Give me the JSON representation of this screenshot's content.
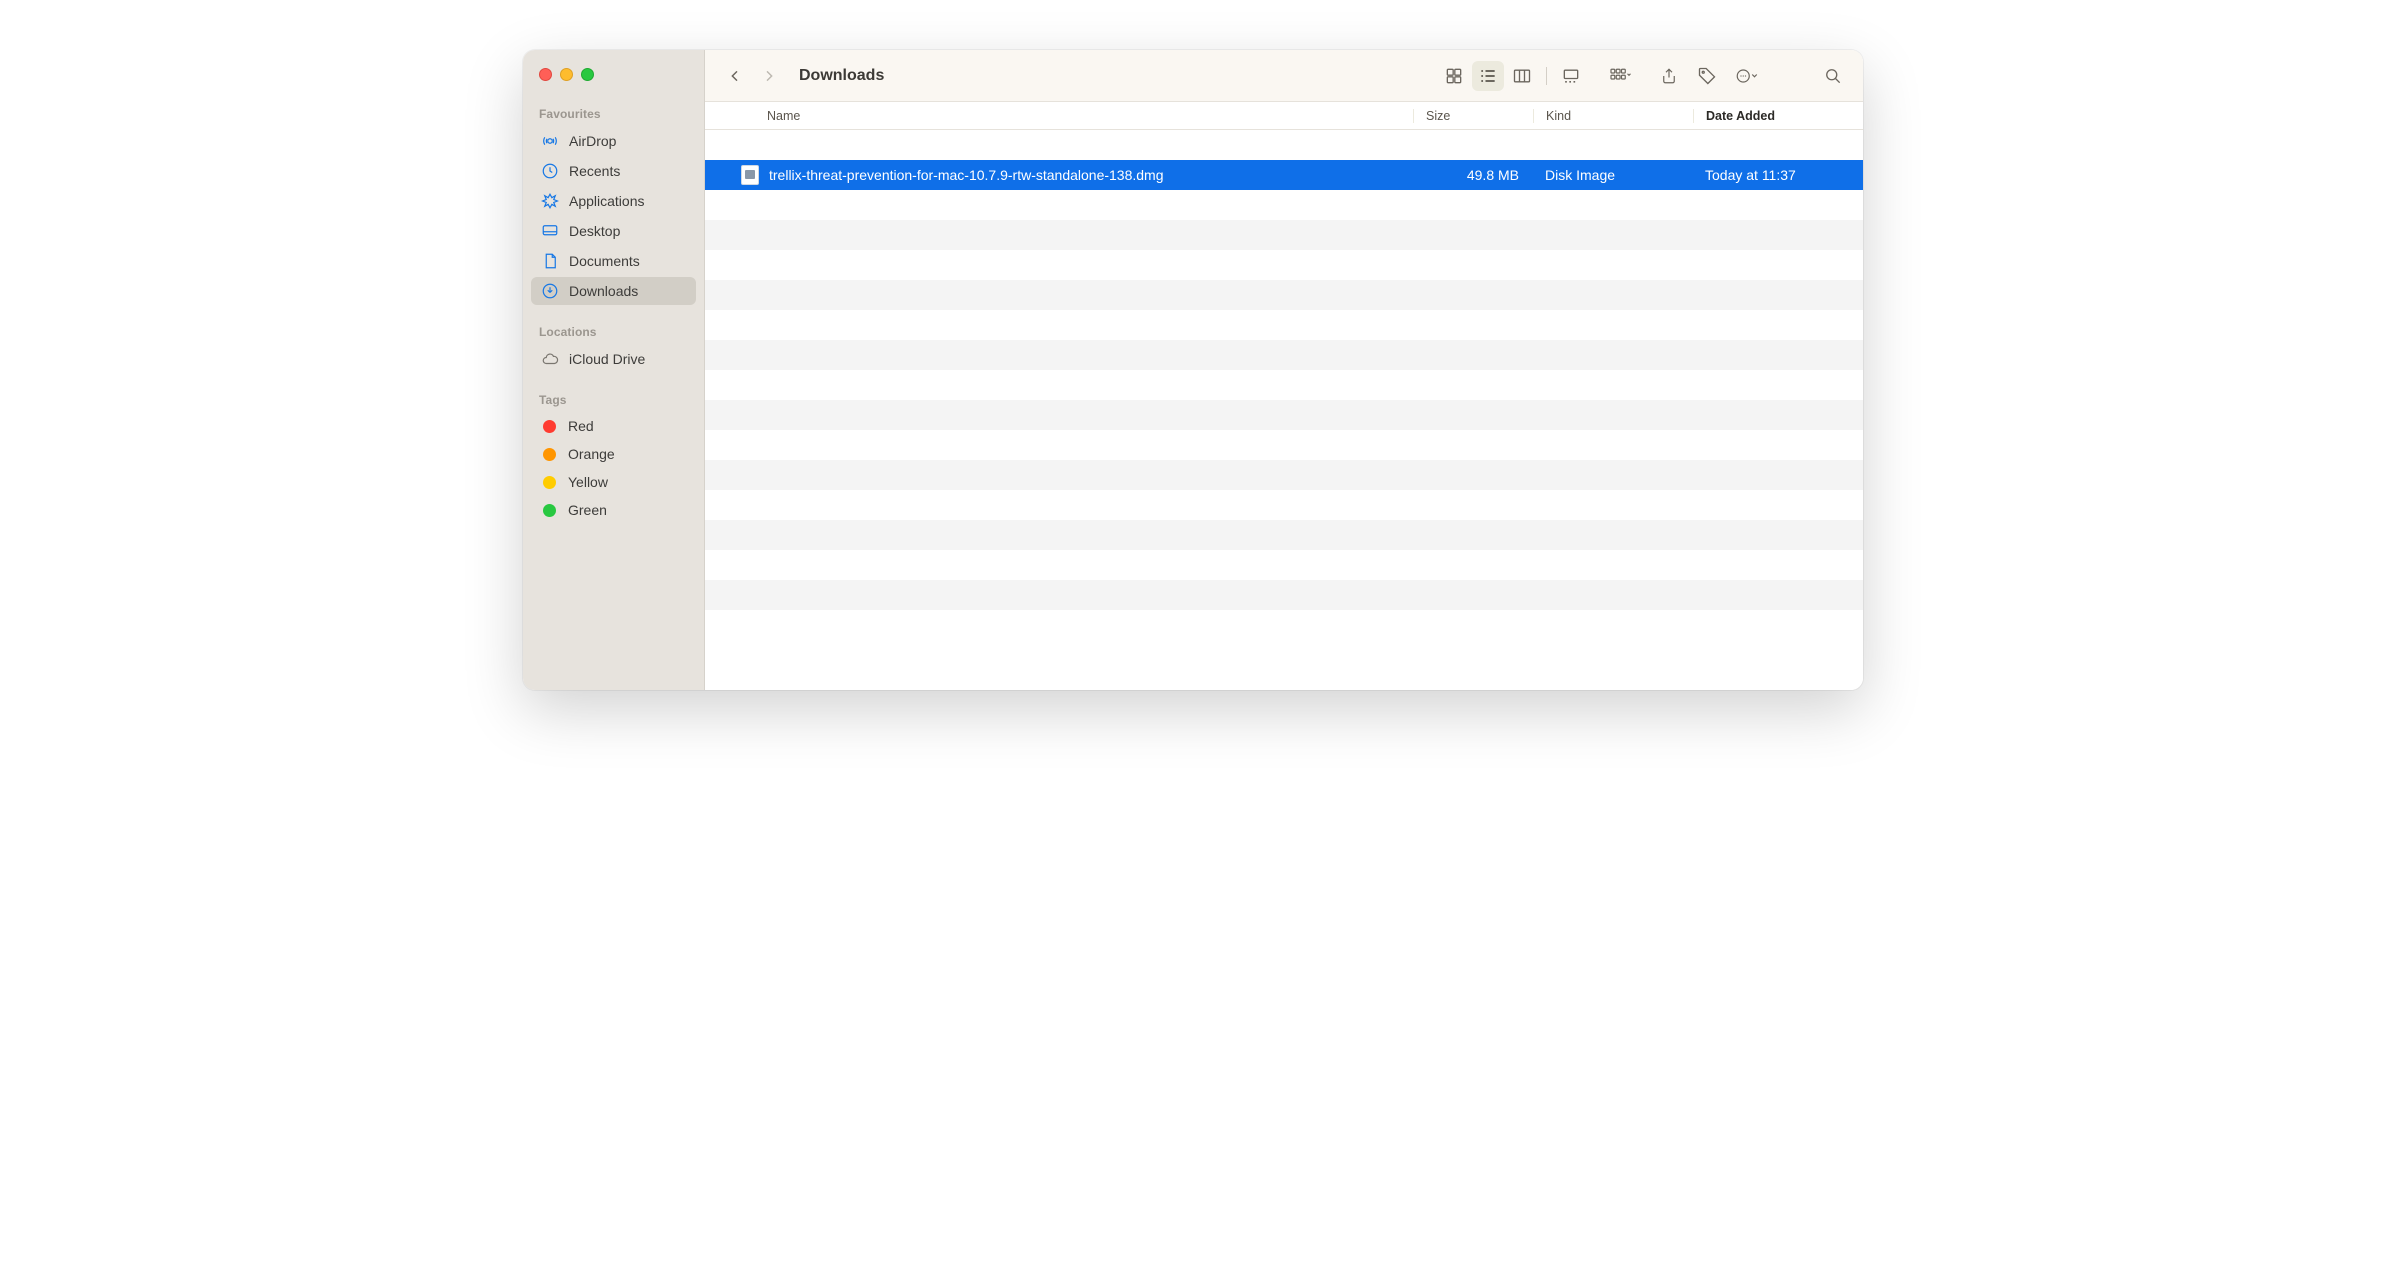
{
  "window": {
    "title": "Downloads"
  },
  "sidebar": {
    "sections": {
      "favourites": {
        "label": "Favourites",
        "items": [
          {
            "label": "AirDrop"
          },
          {
            "label": "Recents"
          },
          {
            "label": "Applications"
          },
          {
            "label": "Desktop"
          },
          {
            "label": "Documents"
          },
          {
            "label": "Downloads"
          }
        ]
      },
      "locations": {
        "label": "Locations",
        "items": [
          {
            "label": "iCloud Drive"
          }
        ]
      },
      "tags": {
        "label": "Tags",
        "items": [
          {
            "label": "Red",
            "color": "#ff3b30"
          },
          {
            "label": "Orange",
            "color": "#ff9500"
          },
          {
            "label": "Yellow",
            "color": "#ffcc00"
          },
          {
            "label": "Green",
            "color": "#28c840"
          }
        ]
      }
    }
  },
  "columns": {
    "name": "Name",
    "size": "Size",
    "kind": "Kind",
    "date": "Date Added"
  },
  "rows": [
    {
      "name": "trellix-threat-prevention-for-mac-10.7.9-rtw-standalone-138.dmg",
      "size": "49.8 MB",
      "kind": "Disk Image",
      "date": "Today at 11:37",
      "selected": true
    }
  ]
}
